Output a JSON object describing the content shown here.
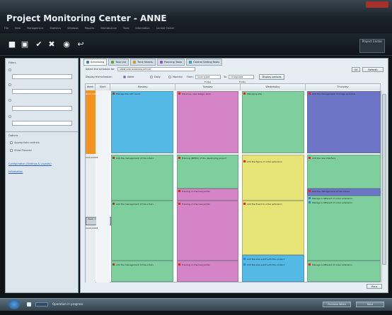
{
  "app": {
    "title": "Project Monitoring Center - ANNE"
  },
  "menu": [
    "File",
    "View",
    "Management",
    "Statistics",
    "Windows",
    "Reports",
    "Maintenance",
    "Tools",
    "Information",
    "Control Center"
  ],
  "toolbar": {
    "icons": [
      "document-icon",
      "document-stack-icon",
      "check-icon",
      "delete-icon",
      "globe-icon",
      "back-icon"
    ],
    "brand": "Project Center"
  },
  "left_panel": {
    "title": "Filters",
    "options_title": "Options",
    "check_1": "Appropriate controls",
    "check_2": "Show Planned",
    "link_1": "Configuration (Settings & Layouts)",
    "link_2": "Information"
  },
  "tabs": [
    "Scheduling",
    "Task List",
    "Time Sheets",
    "Planning Tasks",
    "Control Setting Tasks"
  ],
  "main": {
    "select_label": "Select the schedule for:",
    "select_value": "ANNE AND WORKERS OFFICE",
    "display_label": "Display the schedule:",
    "radio_1": "Week",
    "radio_2": "Daily",
    "radio_3": "Monthly",
    "from_label": "From:",
    "from_value": "04/07/2008",
    "to_label": "To:",
    "to_value": "11/08/2008",
    "sub_from": "Friday",
    "sub_to": "Friday",
    "show_button": "Display periods",
    "ok_button": "OK",
    "refresh_button": "Refresh",
    "print_button": "Print"
  },
  "calendar": {
    "columns": [
      "Week",
      "Start",
      "Monday",
      "Tuesday",
      "Wednesday",
      "Thursday"
    ],
    "time_labels": [
      "04/07/2008",
      "04/14/2008",
      "04/21/2008"
    ],
    "selected_tooltip": "Week 17",
    "events": [
      "Manage the CRF client",
      "Planning, new design, work",
      "Managing site",
      "Add the management of image and data",
      "Add the management of the orders",
      "Training (NEWS) of the developing project",
      "Add the figure of order extension",
      "Add the new interface",
      "Training on the new portal",
      "Add the management of the orders",
      "Manage a different of order extension",
      "Manage a different of order extension",
      "Add the management of the orders",
      "Training on the new portal",
      "Add the Event to order extension",
      "Add the management of the orders",
      "Training on the new portal",
      "Add the site event with the contact",
      "Add the site event with the contact",
      "Manage a different of order extension"
    ]
  },
  "status": {
    "text": "Operation in progress",
    "btn_a": "Previous Week",
    "btn_b": "Next"
  },
  "colors": {
    "blue": "#55b9e6",
    "pink": "#d684c8",
    "green": "#7fce9e",
    "purple": "#6d75c6",
    "yellow": "#e6e477",
    "orange": "#f39223",
    "marker_red": "#d42a1c"
  }
}
